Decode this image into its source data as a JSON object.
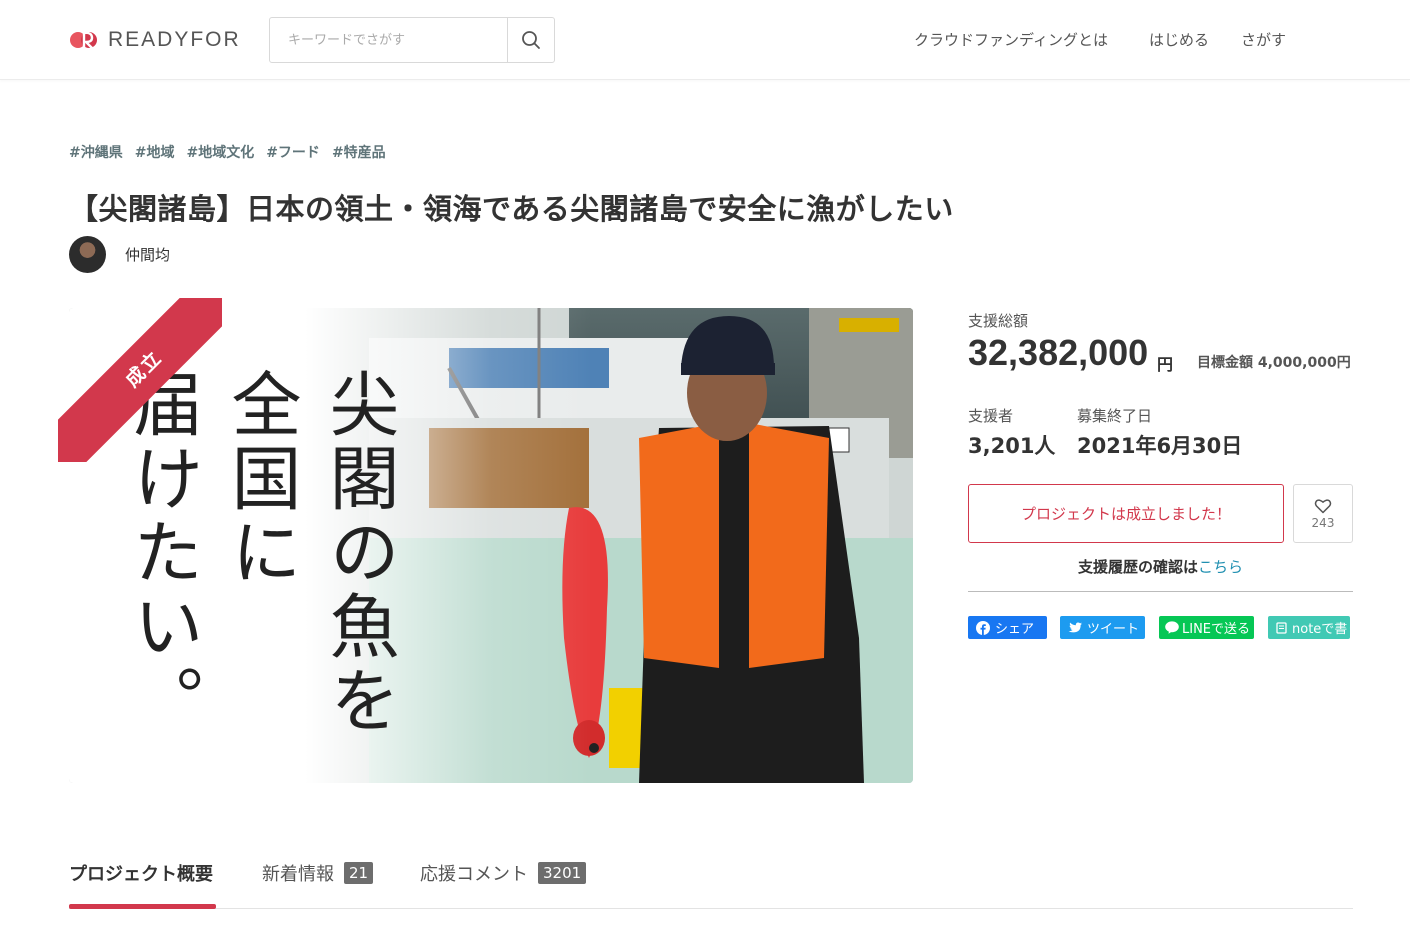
{
  "header": {
    "logo_text": "READYFOR",
    "search_placeholder": "キーワードでさがす",
    "nav": [
      "クラウドファンディングとは",
      "はじめる",
      "さがす"
    ]
  },
  "project": {
    "tags": [
      "#沖縄県",
      "#地域",
      "#地域文化",
      "#フード",
      "#特産品"
    ],
    "title": "【尖閣諸島】日本の領土・領海である尖閣諸島で安全に漁がしたい",
    "owner_name": "仲間均",
    "status_ribbon": "成立",
    "hero_text_right": "尖閣の魚を",
    "hero_text_mid": "全国に",
    "hero_text_left": "届けたい。"
  },
  "stats": {
    "total_label": "支援総額",
    "total_amount": "32,382,000",
    "total_unit": "円",
    "goal_text": "目標金額 4,000,000円",
    "supporters_label": "支援者",
    "supporters_value": "3,201人",
    "end_label": "募集終了日",
    "end_value": "2021年6月30日",
    "success_button": "プロジェクトは成立しました！",
    "favorite_count": "243",
    "history_text": "支援履歴の確認は",
    "history_link": "こちら"
  },
  "share": {
    "facebook": "シェア",
    "twitter": "ツイート",
    "line": "LINEで送る",
    "note": "noteで書く"
  },
  "tabs": [
    {
      "label": "プロジェクト概要",
      "count": ""
    },
    {
      "label": "新着情報",
      "count": "21"
    },
    {
      "label": "応援コメント",
      "count": "3201"
    }
  ],
  "colors": {
    "accent": "#d2384c",
    "tag": "#5f7479",
    "facebook": "#1877f2",
    "twitter": "#1d9bf0",
    "line": "#06c755",
    "note": "#41c9b4",
    "link": "#1f8fb0"
  }
}
